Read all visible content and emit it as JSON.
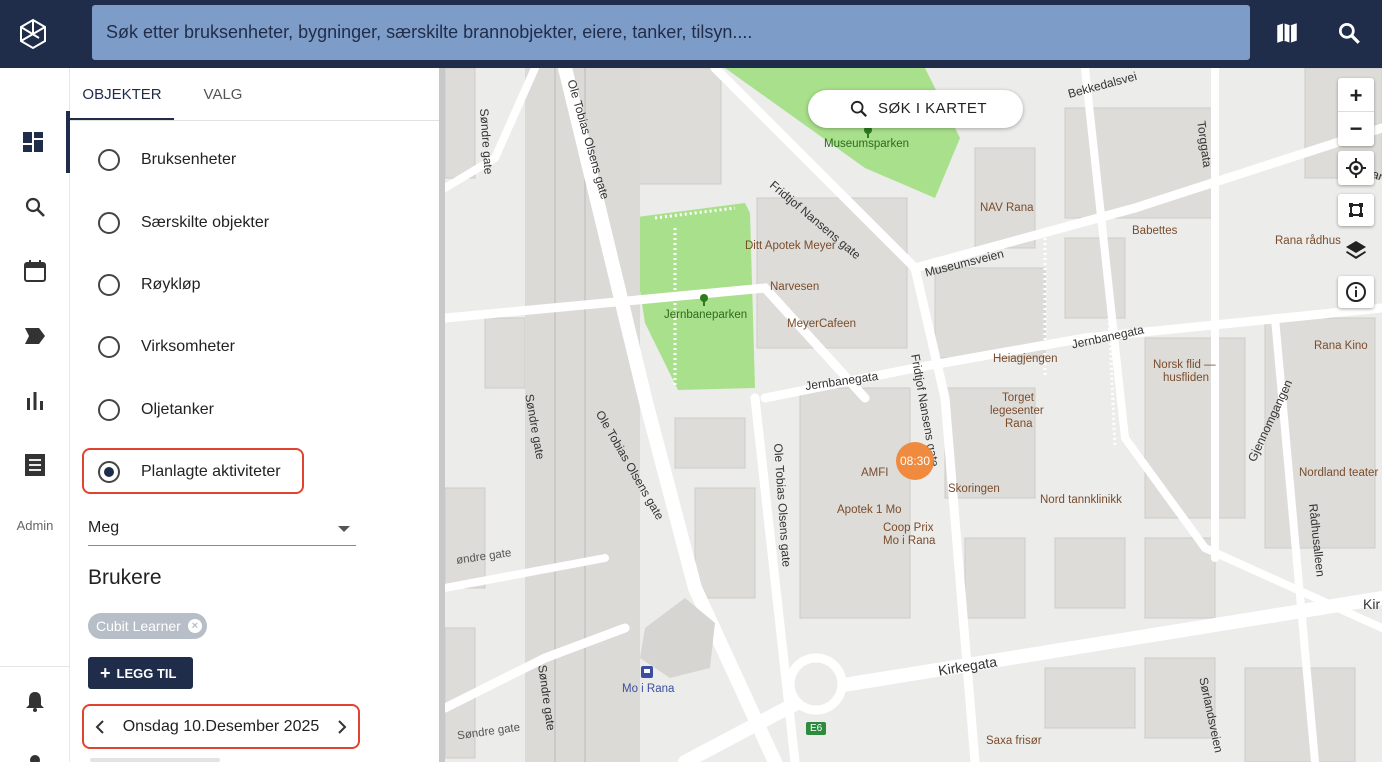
{
  "topbar": {
    "search_placeholder": "Søk etter bruksenheter, bygninger, særskilte brannobjekter, eiere, tanker, tilsyn....",
    "icons": [
      "map-icon",
      "search-icon"
    ]
  },
  "rail": {
    "items": [
      "dashboard-icon",
      "search-icon",
      "calendar-icon",
      "label-icon",
      "bar-chart-icon",
      "list-icon"
    ],
    "admin_label": "Admin",
    "bottom_icons": [
      "bell-icon",
      "user-icon"
    ]
  },
  "panel": {
    "tabs": [
      {
        "label": "OBJEKTER",
        "active": true
      },
      {
        "label": "VALG",
        "active": false
      }
    ],
    "options": [
      {
        "label": "Bruksenheter",
        "checked": false
      },
      {
        "label": "Særskilte objekter",
        "checked": false
      },
      {
        "label": "Røykløp",
        "checked": false
      },
      {
        "label": "Virksomheter",
        "checked": false
      },
      {
        "label": "Oljetanker",
        "checked": false
      },
      {
        "label": "Planlagte aktiviteter",
        "checked": true
      }
    ],
    "filter_select": "Meg",
    "users_heading": "Brukere",
    "user_chip": "Cubit Learner",
    "add_button": "LEGG TIL",
    "date": "Onsdag 10.Desember 2025"
  },
  "map": {
    "search_button": "SØK I KARTET",
    "zoom_in": "+",
    "zoom_out": "−",
    "controls": [
      "locate-icon",
      "draw-polygon-icon",
      "layers-icon",
      "info-icon"
    ],
    "marker_time": "08:30",
    "route_badge": "E6",
    "labels": {
      "museumsparken": "Museumsparken",
      "jernbaneparken": "Jernbaneparken",
      "ditt_apotek": "Ditt Apotek Meyer",
      "narvesen": "Narvesen",
      "meyercafeen": "MeyerCafeen",
      "nav_rana": "NAV Rana",
      "babettes": "Babettes",
      "rana_radhus": "Rana rådhus",
      "rana_kino": "Rana Kino",
      "heiagjengen": "Heiagjengen",
      "norsk_flid": "Norsk flid —",
      "husfliden": "husfliden",
      "torget_1": "Torget",
      "torget_2": "legesenter",
      "torget_3": "Rana",
      "amfi": "AMFI",
      "skoringen": "Skoringen",
      "nord_tannklinikk": "Nord tannklinikk",
      "apotek_1_mo": "Apotek 1 Mo",
      "coop_1": "Coop Prix",
      "coop_2": "Mo i Rana",
      "nordland_teater": "Nordland teater",
      "mo_i_rana": "Mo i Rana",
      "saxa_frisor": "Saxa frisør",
      "kirkegata": "Kirkegata",
      "jernbanegata_1": "Jernbanegata",
      "jernbanegata_2": "Jernbanegata",
      "museumsveien": "Museumsveien",
      "fridtjof_1": "Fridtjof Nansens gate",
      "fridtjof_2": "Fridtjof Nansens gate",
      "ole_tobias_1": "Ole Tobias Olsens gate",
      "ole_tobias_2": "Ole Tobias Olsens gate",
      "ole_tobias_3": "Ole Tobias Olsens gate",
      "sondre_1": "Søndre gate",
      "sondre_2": "Søndre gate",
      "sondre_3": "Søndre gate",
      "sondre_4": "øndre gate",
      "sondre_5": "Søndre gate",
      "torggata": "Torggata",
      "bekkedalsvei": "Bekkedalsvei",
      "gjenomgangen": "Gjennomgangen",
      "radhusalleen": "Rådhusalleen",
      "sorlandsveien": "Sørlandsveien",
      "kolandsv": "Kolands",
      "kir_edge": "Kir"
    }
  }
}
